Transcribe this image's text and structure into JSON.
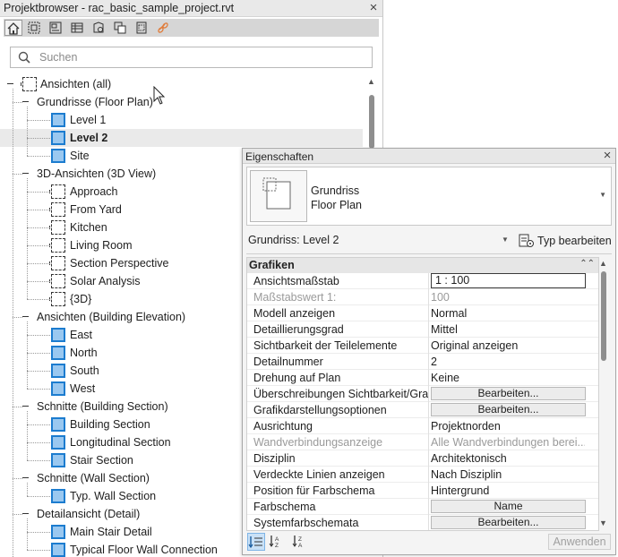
{
  "project_browser": {
    "title": "Projektbrowser - rac_basic_sample_project.rvt",
    "close_label": "×",
    "search_placeholder": "Suchen",
    "toolbar_icons": [
      "home-icon",
      "view-icon",
      "sheet-icon",
      "schedule-icon",
      "family-icon",
      "group-icon",
      "link-view-icon",
      "revit-link-icon"
    ],
    "root": "Ansichten (all)",
    "groups": [
      {
        "label": "Grundrisse (Floor Plan)",
        "items": [
          "Level 1",
          "Level 2",
          "Site"
        ]
      },
      {
        "label": "3D-Ansichten (3D View)",
        "items": [
          "Approach",
          "From Yard",
          "Kitchen",
          "Living Room",
          "Section Perspective",
          "Solar Analysis",
          "{3D}"
        ]
      },
      {
        "label": "Ansichten (Building Elevation)",
        "items": [
          "East",
          "North",
          "South",
          "West"
        ]
      },
      {
        "label": "Schnitte (Building Section)",
        "items": [
          "Building Section",
          "Longitudinal Section",
          "Stair Section"
        ]
      },
      {
        "label": "Schnitte (Wall Section)",
        "items": [
          "Typ. Wall Section"
        ]
      },
      {
        "label": "Detailansicht (Detail)",
        "items": [
          "Main Stair Detail",
          "Typical Floor Wall Connection"
        ]
      }
    ],
    "selected_item": "Level 2"
  },
  "properties": {
    "title": "Eigenschaften",
    "close_label": "×",
    "type_name_1": "Grundriss",
    "type_name_2": "Floor Plan",
    "instance_selector": "Grundriss: Level 2",
    "edit_type_label": "Typ bearbeiten",
    "group_label": "Grafiken",
    "rows": [
      {
        "name": "Ansichtsmaßstab",
        "value": "1 : 100",
        "kind": "box"
      },
      {
        "name": "Maßstabswert 1:",
        "value": "100",
        "kind": "dim"
      },
      {
        "name": "Modell anzeigen",
        "value": "Normal",
        "kind": "text"
      },
      {
        "name": "Detaillierungsgrad",
        "value": "Mittel",
        "kind": "text"
      },
      {
        "name": "Sichtbarkeit der Teilelemente",
        "value": "Original anzeigen",
        "kind": "text"
      },
      {
        "name": "Detailnummer",
        "value": "2",
        "kind": "text"
      },
      {
        "name": "Drehung auf Plan",
        "value": "Keine",
        "kind": "text"
      },
      {
        "name": "Überschreibungen Sichtbarkeit/Gra...",
        "value": "Bearbeiten...",
        "kind": "button"
      },
      {
        "name": "Grafikdarstellungsoptionen",
        "value": "Bearbeiten...",
        "kind": "button"
      },
      {
        "name": "Ausrichtung",
        "value": "Projektnorden",
        "kind": "text"
      },
      {
        "name": "Wandverbindungsanzeige",
        "value": "Alle Wandverbindungen berei...",
        "kind": "dim"
      },
      {
        "name": "Disziplin",
        "value": "Architektonisch",
        "kind": "text"
      },
      {
        "name": "Verdeckte Linien anzeigen",
        "value": "Nach Disziplin",
        "kind": "text"
      },
      {
        "name": "Position für Farbschema",
        "value": "Hintergrund",
        "kind": "text"
      },
      {
        "name": "Farbschema",
        "value": "Name",
        "kind": "button"
      },
      {
        "name": "Systemfarbschemata",
        "value": "Bearbeiten...",
        "kind": "button"
      }
    ],
    "apply_label": "Anwenden",
    "accent_color": "#1c7ccf"
  }
}
